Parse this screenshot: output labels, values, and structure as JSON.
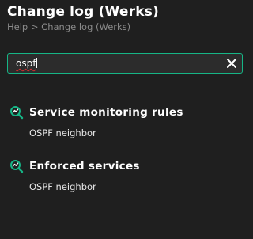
{
  "header": {
    "title": "Change log (Werks)",
    "breadcrumb": "Help > Change log (Werks)"
  },
  "search": {
    "value": "ospf",
    "clear_icon": "close-icon"
  },
  "results": [
    {
      "icon": "search-result-icon",
      "title": "Service monitoring rules",
      "items": [
        "OSPF neighbor"
      ]
    },
    {
      "icon": "search-result-icon",
      "title": "Enforced services",
      "items": [
        "OSPF neighbor"
      ]
    }
  ],
  "colors": {
    "background": "#1f1f1f",
    "accent": "#16b586",
    "input_bg": "#2c2c2c",
    "muted_text": "#8a8a8a"
  }
}
